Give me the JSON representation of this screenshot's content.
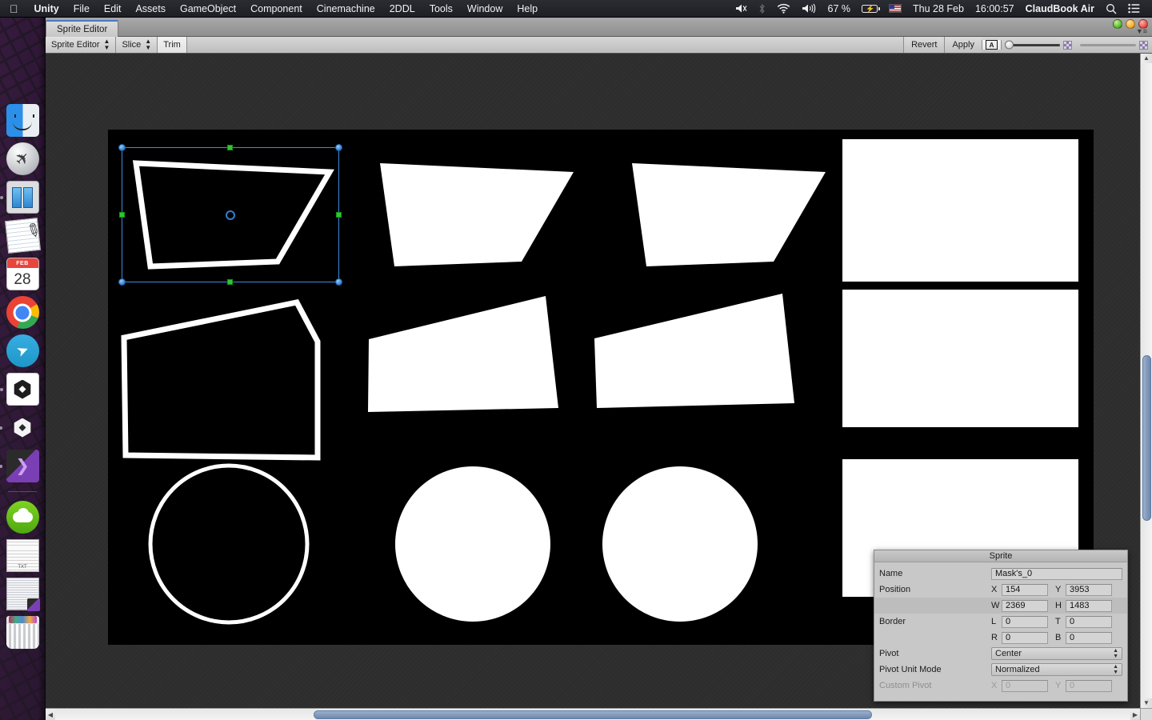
{
  "menubar": {
    "apple_icon": "apple-icon",
    "items": [
      {
        "label": "Unity",
        "bold": true
      },
      {
        "label": "File",
        "bold": false
      },
      {
        "label": "Edit",
        "bold": false
      },
      {
        "label": "Assets",
        "bold": false
      },
      {
        "label": "GameObject",
        "bold": false
      },
      {
        "label": "Component",
        "bold": false
      },
      {
        "label": "Cinemachine",
        "bold": false
      },
      {
        "label": "2DDL",
        "bold": false
      },
      {
        "label": "Tools",
        "bold": false
      },
      {
        "label": "Window",
        "bold": false
      },
      {
        "label": "Help",
        "bold": false
      }
    ],
    "status": {
      "volume_mute_icon": "volume-mute-icon",
      "bluetooth_icon": "bluetooth-icon",
      "wifi_icon": "wifi-icon",
      "sound_icon": "sound-icon",
      "battery_percent": "67 %",
      "battery_icon": "battery-charging-icon",
      "flag_icon": "us-flag-icon",
      "date": "Thu 28 Feb",
      "time": "16:00:57",
      "device_name": "ClaudBook Air",
      "search_icon": "search-icon",
      "control_center_icon": "control-center-icon"
    }
  },
  "dock": {
    "items": [
      {
        "name": "finder",
        "running": true
      },
      {
        "name": "launchpad",
        "running": false
      },
      {
        "name": "books",
        "running": true
      },
      {
        "name": "notes",
        "running": false
      },
      {
        "name": "calendar",
        "running": false,
        "month": "FEB",
        "day": "28"
      },
      {
        "name": "chrome",
        "running": true
      },
      {
        "name": "telegram",
        "running": false
      },
      {
        "name": "unity-hub",
        "running": true
      },
      {
        "name": "unity",
        "running": true
      },
      {
        "name": "visual-studio",
        "running": true
      },
      {
        "name": "separator"
      },
      {
        "name": "cloud-storage",
        "running": false
      },
      {
        "name": "text-document",
        "running": false
      },
      {
        "name": "code-document",
        "running": false
      },
      {
        "name": "trash",
        "running": false
      }
    ]
  },
  "window": {
    "tab_label": "Sprite Editor",
    "buttons": {
      "close": "close-button",
      "minimize": "minimize-button",
      "zoom": "zoom-button"
    },
    "menu_icon": "window-menu-icon"
  },
  "toolbar": {
    "mode_label": "Sprite Editor",
    "slice_label": "Slice",
    "trim_label": "Trim",
    "revert_label": "Revert",
    "apply_label": "Apply",
    "alpha_button_icon": "alpha-channel-icon",
    "alpha_button_letter": "A",
    "zoom_slider_value": 0,
    "color_slider_value": 100,
    "checker_icon": "checker-icon"
  },
  "sprite_panel": {
    "title": "Sprite",
    "fields": {
      "name_label": "Name",
      "name_value": "Mask's_0",
      "position_label": "Position",
      "position_x_axis": "X",
      "position_x": "154",
      "position_y_axis": "Y",
      "position_y": "3953",
      "size_w_axis": "W",
      "size_w": "2369",
      "size_h_axis": "H",
      "size_h": "1483",
      "border_label": "Border",
      "border_l_axis": "L",
      "border_l": "0",
      "border_t_axis": "T",
      "border_t": "0",
      "border_r_axis": "R",
      "border_r": "0",
      "border_b_axis": "B",
      "border_b": "0",
      "pivot_label": "Pivot",
      "pivot_value": "Center",
      "pivot_unit_label": "Pivot Unit Mode",
      "pivot_unit_value": "Normalized",
      "custom_pivot_label": "Custom Pivot",
      "custom_pivot_x_axis": "X",
      "custom_pivot_x": "0",
      "custom_pivot_y_axis": "Y",
      "custom_pivot_y": "0"
    }
  },
  "canvas": {
    "background_color": "#000000",
    "sprite_fill": "#ffffff",
    "selection": {
      "border_color": "#3d8bda",
      "corner_handle_color": "#2f7fd0",
      "edge_handle_color": "#2ec72e",
      "pivot_marker": "pivot-center-marker"
    },
    "sprites": [
      {
        "row": 1,
        "col": 1,
        "shape": "trapezoid-outline",
        "selected": true
      },
      {
        "row": 1,
        "col": 2,
        "shape": "trapezoid-filled",
        "selected": false
      },
      {
        "row": 1,
        "col": 3,
        "shape": "trapezoid-filled",
        "selected": false
      },
      {
        "row": 1,
        "col": 4,
        "shape": "rectangle-filled",
        "selected": false
      },
      {
        "row": 2,
        "col": 1,
        "shape": "quad-outline",
        "selected": false
      },
      {
        "row": 2,
        "col": 2,
        "shape": "quad-filled",
        "selected": false
      },
      {
        "row": 2,
        "col": 3,
        "shape": "quad-filled",
        "selected": false
      },
      {
        "row": 2,
        "col": 4,
        "shape": "rectangle-filled",
        "selected": false
      },
      {
        "row": 3,
        "col": 1,
        "shape": "circle-outline",
        "selected": false
      },
      {
        "row": 3,
        "col": 2,
        "shape": "circle-filled",
        "selected": false
      },
      {
        "row": 3,
        "col": 3,
        "shape": "circle-filled",
        "selected": false
      },
      {
        "row": 3,
        "col": 4,
        "shape": "rectangle-filled",
        "selected": false
      }
    ]
  },
  "scrollbars": {
    "horizontal": {
      "left_arrow": "scroll-left-arrow",
      "right_arrow": "scroll-right-arrow"
    },
    "vertical": {
      "up_arrow": "scroll-up-arrow",
      "down_arrow": "scroll-down-arrow"
    }
  }
}
